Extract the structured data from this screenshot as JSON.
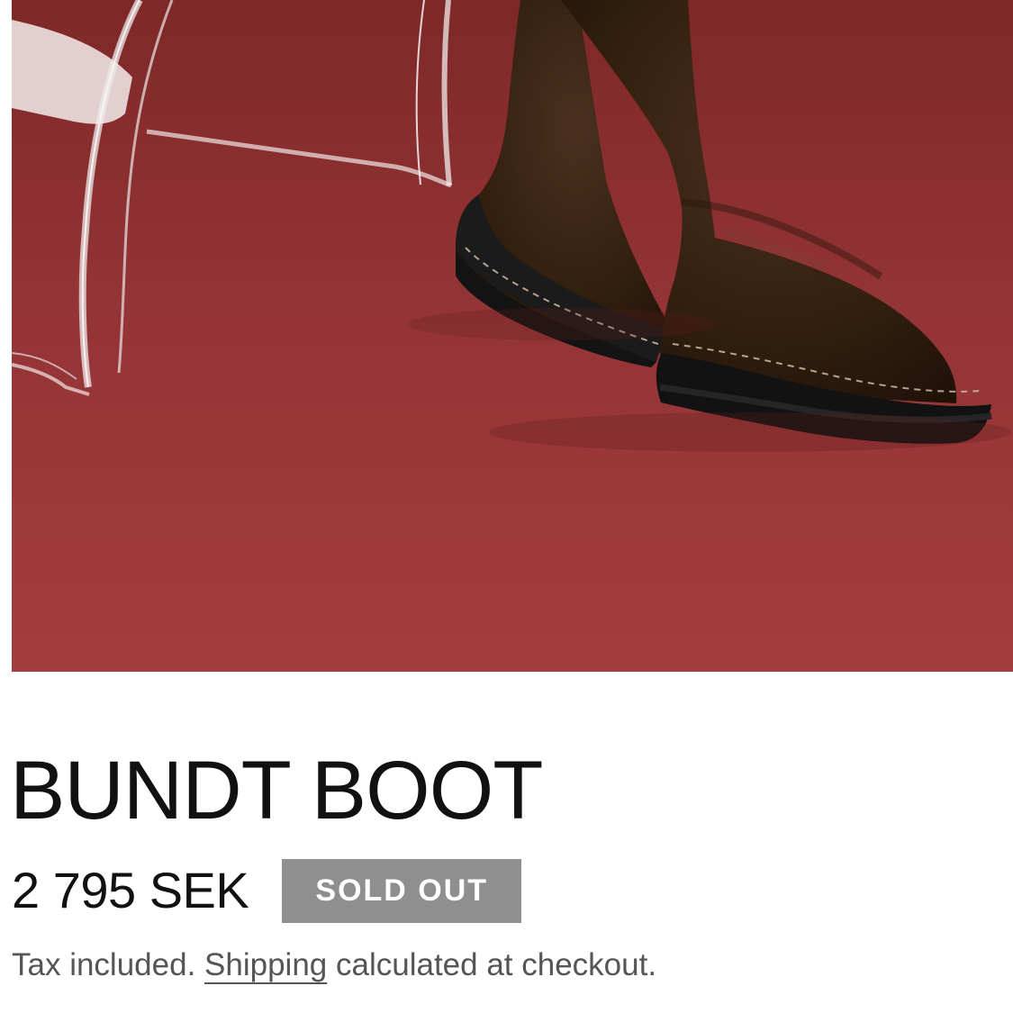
{
  "product": {
    "title": "BUNDT BOOT",
    "price": "2 795 SEK",
    "sold_out_label": "SOLD OUT",
    "tax_note_prefix": "Tax included.",
    "shipping_link_label": "Shipping",
    "tax_note_suffix": "calculated at checkout."
  },
  "image": {
    "subject": "brown suede boots on red floor beside clear acrylic chair",
    "background_color": "#a23a3b",
    "boot_color": "#3a2418",
    "sole_color": "#141414"
  },
  "colors": {
    "text": "#111111",
    "muted_text": "#555555",
    "sold_out_background": "#8f8f8f",
    "sold_out_text": "#ffffff"
  }
}
